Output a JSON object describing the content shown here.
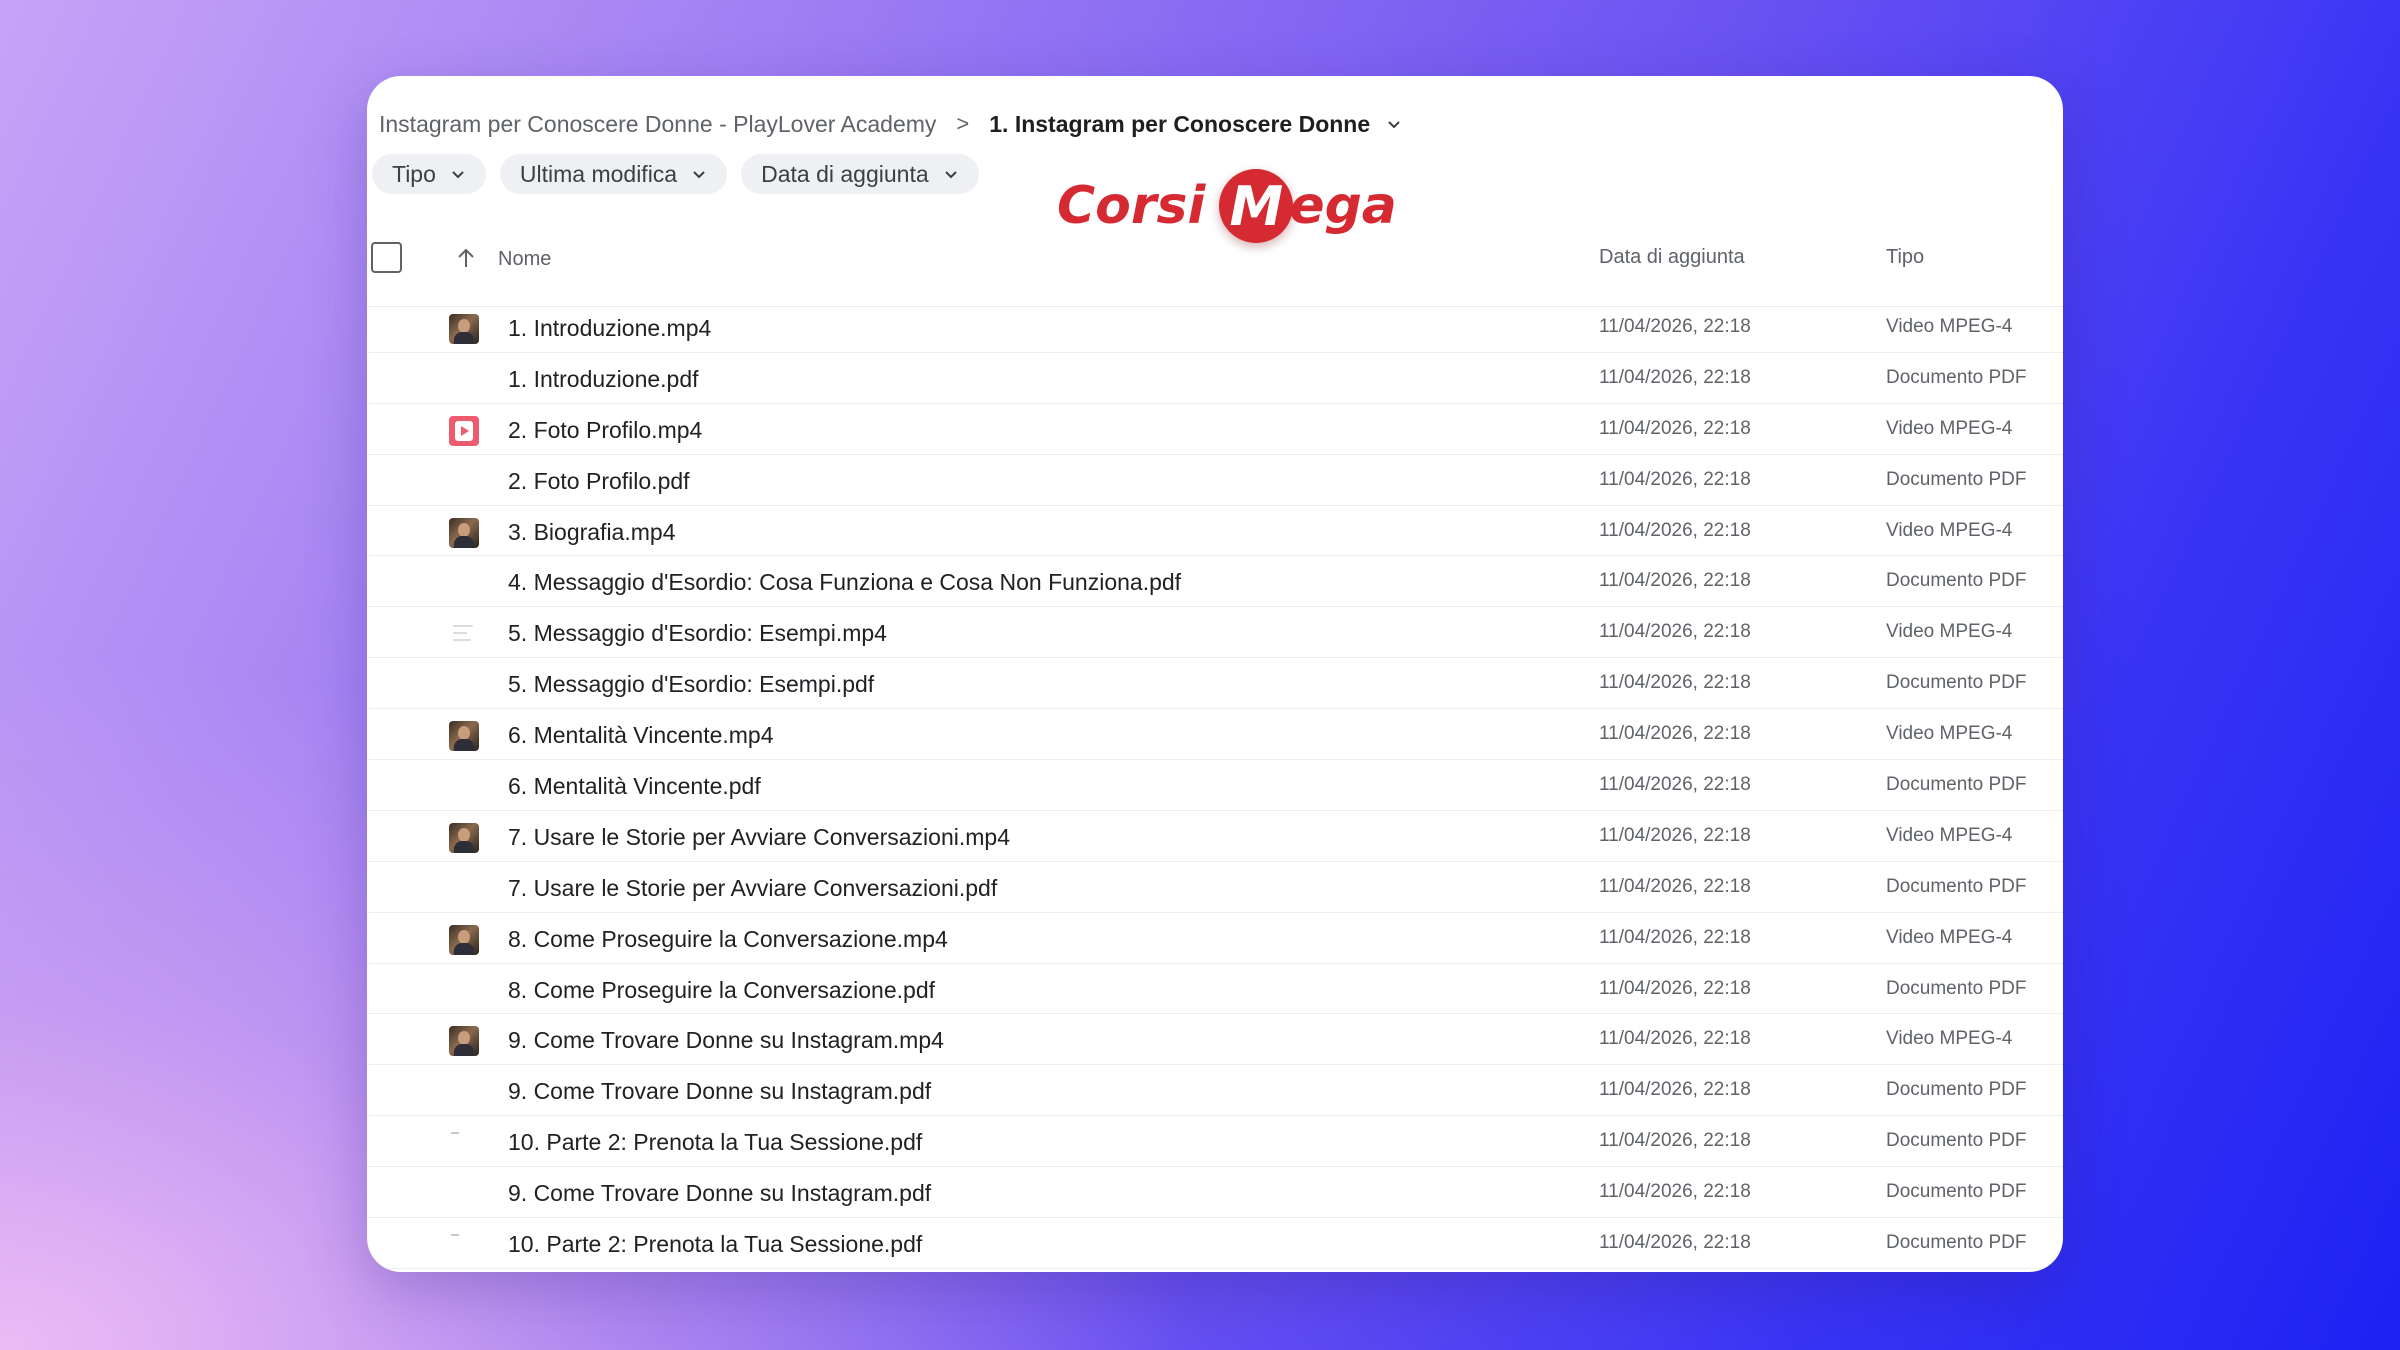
{
  "breadcrumb": {
    "parent": "Instagram per Conoscere Donne - PlayLover Academy",
    "separator": ">",
    "current": "1. Instagram per Conoscere Donne"
  },
  "filters": [
    "Tipo",
    "Ultima modifica",
    "Data di aggiunta"
  ],
  "watermark": {
    "text_left": "Corsi",
    "text_m": "M",
    "text_right": "ega",
    "color": "#d62a32"
  },
  "columns": {
    "name": "Nome",
    "date": "Data di aggiunta",
    "type": "Tipo"
  },
  "files": [
    {
      "name": "1. Introduzione.mp4",
      "date": "11/04/2026, 22:18",
      "type": "Video MPEG-4",
      "thumb": "photo"
    },
    {
      "name": "1. Introduzione.pdf",
      "date": "11/04/2026, 22:18",
      "type": "Documento PDF",
      "thumb": "none"
    },
    {
      "name": "2. Foto Profilo.mp4",
      "date": "11/04/2026, 22:18",
      "type": "Video MPEG-4",
      "thumb": "app"
    },
    {
      "name": "2. Foto Profilo.pdf",
      "date": "11/04/2026, 22:18",
      "type": "Documento PDF",
      "thumb": "none"
    },
    {
      "name": "3. Biografia.mp4",
      "date": "11/04/2026, 22:18",
      "type": "Video MPEG-4",
      "thumb": "photo"
    },
    {
      "name": "4. Messaggio d'Esordio: Cosa Funziona e Cosa Non Funziona.pdf",
      "date": "11/04/2026, 22:18",
      "type": "Documento PDF",
      "thumb": "none"
    },
    {
      "name": "5. Messaggio d'Esordio: Esempi.mp4",
      "date": "11/04/2026, 22:18",
      "type": "Video MPEG-4",
      "thumb": "faint"
    },
    {
      "name": "5. Messaggio d'Esordio: Esempi.pdf",
      "date": "11/04/2026, 22:18",
      "type": "Documento PDF",
      "thumb": "none"
    },
    {
      "name": "6. Mentalità Vincente.mp4",
      "date": "11/04/2026, 22:18",
      "type": "Video MPEG-4",
      "thumb": "photo"
    },
    {
      "name": "6. Mentalità Vincente.pdf",
      "date": "11/04/2026, 22:18",
      "type": "Documento PDF",
      "thumb": "none"
    },
    {
      "name": "7. Usare le Storie per Avviare Conversazioni.mp4",
      "date": "11/04/2026, 22:18",
      "type": "Video MPEG-4",
      "thumb": "photo"
    },
    {
      "name": "7. Usare le Storie per Avviare Conversazioni.pdf",
      "date": "11/04/2026, 22:18",
      "type": "Documento PDF",
      "thumb": "none"
    },
    {
      "name": "8. Come Proseguire la Conversazione.mp4",
      "date": "11/04/2026, 22:18",
      "type": "Video MPEG-4",
      "thumb": "photo"
    },
    {
      "name": "8. Come Proseguire la Conversazione.pdf",
      "date": "11/04/2026, 22:18",
      "type": "Documento PDF",
      "thumb": "none"
    },
    {
      "name": "9. Come Trovare Donne su Instagram.mp4",
      "date": "11/04/2026, 22:18",
      "type": "Video MPEG-4",
      "thumb": "photo"
    },
    {
      "name": "9. Come Trovare Donne su Instagram.pdf",
      "date": "11/04/2026, 22:18",
      "type": "Documento PDF",
      "thumb": "none"
    },
    {
      "name": "10. Parte 2: Prenota la Tua Sessione.pdf",
      "date": "11/04/2026, 22:18",
      "type": "Documento PDF",
      "thumb": "dot"
    },
    {
      "name": "9. Come Trovare Donne su Instagram.pdf",
      "date": "11/04/2026, 22:18",
      "type": "Documento PDF",
      "thumb": "none"
    },
    {
      "name": "10. Parte 2: Prenota la Tua Sessione.pdf",
      "date": "11/04/2026, 22:18",
      "type": "Documento PDF",
      "thumb": "dot"
    }
  ]
}
